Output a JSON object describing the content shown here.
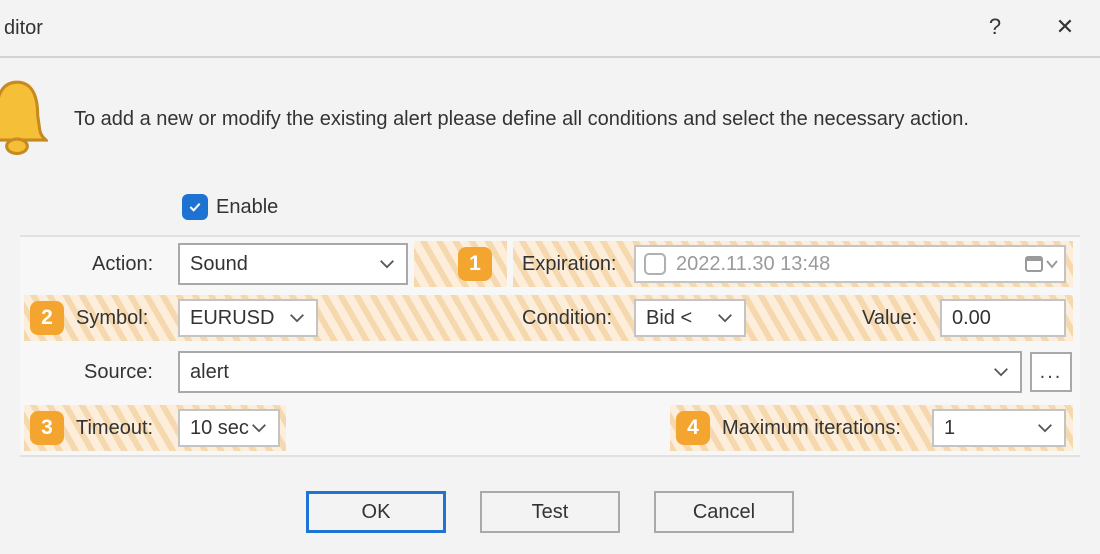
{
  "window": {
    "title": "ditor",
    "help": "?",
    "close": "✕"
  },
  "intro": "To add a new or modify the existing alert please define all conditions and select the necessary action.",
  "enable_label": "Enable",
  "callouts": {
    "c1": "1",
    "c2": "2",
    "c3": "3",
    "c4": "4"
  },
  "labels": {
    "action": "Action:",
    "expiration": "Expiration:",
    "symbol": "Symbol:",
    "condition": "Condition:",
    "value": "Value:",
    "source": "Source:",
    "timeout": "Timeout:",
    "maxiter": "Maximum iterations:"
  },
  "fields": {
    "action": "Sound",
    "expiration_date": "2022.11.30 13:48",
    "symbol": "EURUSD",
    "condition": "Bid <",
    "value": "0.00",
    "source": "alert",
    "timeout": "10 sec",
    "maxiter": "1"
  },
  "footer": {
    "ok": "OK",
    "test": "Test",
    "cancel": "Cancel"
  },
  "dots": "..."
}
